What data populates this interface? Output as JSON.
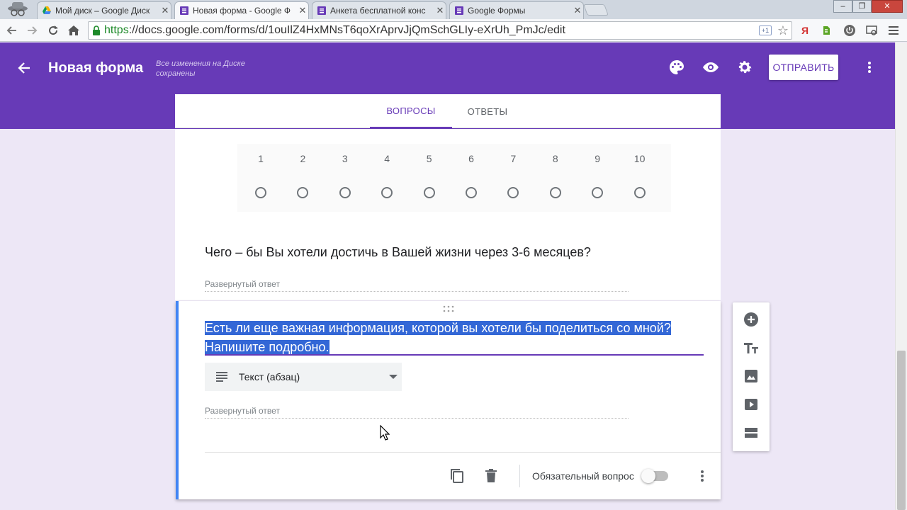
{
  "browser": {
    "tabs": [
      {
        "title": "Мой диск – Google Диск"
      },
      {
        "title": "Новая форма - Google Ф"
      },
      {
        "title": "Анкета бесплатной конс"
      },
      {
        "title": "Google Формы"
      }
    ],
    "url": {
      "scheme": "https",
      "rest": "://docs.google.com/forms/d/1ouIlZ4HxMNsT6qoXrAprvJjQmSchGLIy-eXrUh_PmJc/edit"
    },
    "extensions": [
      "translate-icon",
      "star-icon",
      "yandex-icon",
      "evernote-icon",
      "power-icon",
      "screenshot-icon",
      "menu-icon"
    ]
  },
  "header": {
    "title": "Новая форма",
    "save_status": "Все изменения на Диске сохранены",
    "send_label": "ОТПРАВИТЬ",
    "accent": "#673ab7"
  },
  "form_tabs": {
    "questions": "ВОПРОСЫ",
    "responses": "ОТВЕТЫ"
  },
  "scale_question": {
    "labels": [
      "1",
      "2",
      "3",
      "4",
      "5",
      "6",
      "7",
      "8",
      "9",
      "10"
    ]
  },
  "question2": {
    "title": "Чего – бы Вы хотели достичь в Вашей жизни через 3-6 месяцев?",
    "answer_hint": "Развернутый ответ"
  },
  "question3": {
    "title": "Есть ли еще важная информация, которой вы хотели бы поделиться со мной? Напишите подробно.",
    "type": "Текст (абзац)",
    "answer_hint": "Развернутый ответ",
    "required_label": "Обязательный вопрос",
    "required": false
  },
  "side_toolbar": [
    "add-question-icon",
    "add-title-icon",
    "add-image-icon",
    "add-video-icon",
    "add-section-icon"
  ]
}
